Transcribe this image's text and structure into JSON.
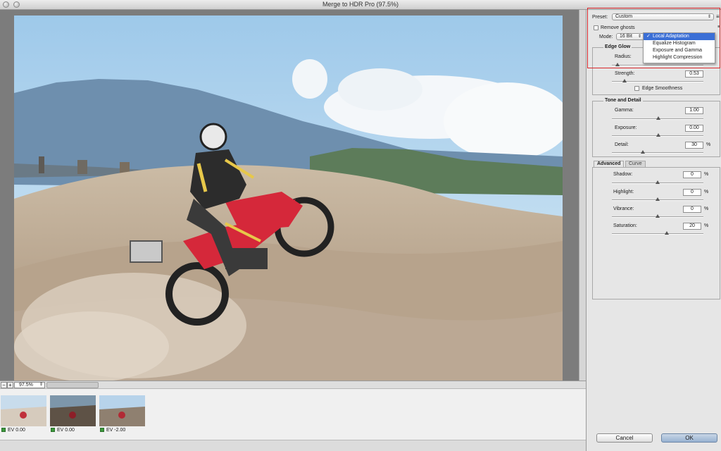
{
  "window": {
    "title": "Merge to HDR Pro (97.5%)"
  },
  "zoom": {
    "value": "97.5%",
    "minus": "−",
    "plus": "+"
  },
  "thumbnails": [
    {
      "label": "EV 0.00"
    },
    {
      "label": "EV 0.00"
    },
    {
      "label": "EV -2.00"
    }
  ],
  "panel": {
    "preset_label": "Preset:",
    "preset_value": "Custom",
    "remove_ghosts_label": "Remove ghosts",
    "mode_label": "Mode:",
    "mode_bit_value": "16 Bit",
    "mode_menu": [
      "Local Adaptation",
      "Equalize Histogram",
      "Exposure and Gamma",
      "Highlight Compression"
    ],
    "mode_selected": "Local Adaptation",
    "check_glyph": "✓",
    "edge_glow": {
      "title": "Edge Glow",
      "radius_label": "Radius:",
      "strength_label": "Strength:",
      "strength_value": "0.53",
      "edge_smoothness_label": "Edge Smoothness"
    },
    "tone_detail": {
      "title": "Tone and Detail",
      "gamma_label": "Gamma:",
      "gamma_value": "1.00",
      "exposure_label": "Exposure:",
      "exposure_value": "0.00",
      "detail_label": "Detail:",
      "detail_value": "30",
      "detail_unit": "%"
    },
    "tabs": [
      "Advanced",
      "Curve"
    ],
    "advanced": {
      "shadow_label": "Shadow:",
      "shadow_value": "0",
      "highlight_label": "Highlight:",
      "highlight_value": "0",
      "vibrance_label": "Vibrance:",
      "vibrance_value": "0",
      "saturation_label": "Saturation:",
      "saturation_value": "20",
      "unit": "%"
    }
  },
  "buttons": {
    "cancel": "Cancel",
    "ok": "OK"
  },
  "colors": {
    "accent": "#3b6fd6",
    "callout": "#d9272b",
    "bike_red": "#d5283a"
  }
}
